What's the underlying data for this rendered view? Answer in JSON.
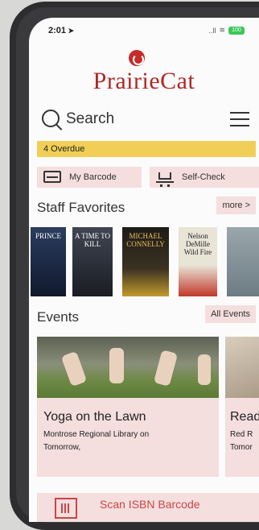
{
  "status_bar": {
    "time": "2:01",
    "signal": "..ll",
    "battery": "100"
  },
  "brand": {
    "name": "PrairieCat",
    "color": "#b22727"
  },
  "search": {
    "label": "Search"
  },
  "alerts": {
    "overdue": "4  Overdue"
  },
  "quick_actions": [
    {
      "label": "My Barcode",
      "icon": "barcode-card-icon"
    },
    {
      "label": "Self-Check",
      "icon": "cart-icon"
    }
  ],
  "staff_favorites": {
    "title": "Staff Favorites",
    "more_label": "more >",
    "books": [
      {
        "cover_text": "PRINCE"
      },
      {
        "cover_text": "A TIME TO KILL"
      },
      {
        "cover_text": "MICHAEL CONNELLY"
      },
      {
        "cover_text": "Nelson DeMille Wild Fire"
      },
      {
        "cover_text": ""
      }
    ]
  },
  "events": {
    "title": "Events",
    "all_label": "All Events",
    "items": [
      {
        "title": "Yoga on the Lawn",
        "location": "Montrose Regional Library on",
        "when": "Tomorrow,"
      },
      {
        "title": "Read",
        "location": "Red R",
        "when": "Tomor"
      }
    ]
  },
  "scan": {
    "label": "Scan ISBN Barcode"
  }
}
